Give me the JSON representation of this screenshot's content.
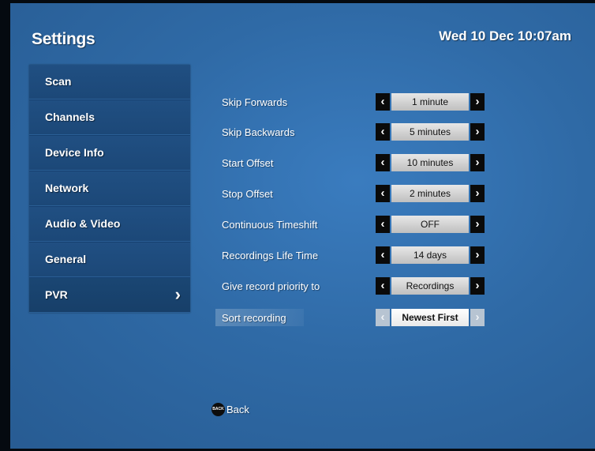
{
  "header": {
    "title": "Settings",
    "datetime": "Wed 10 Dec 10:07am"
  },
  "sidebar": {
    "items": [
      {
        "label": "Scan"
      },
      {
        "label": "Channels"
      },
      {
        "label": "Device Info"
      },
      {
        "label": "Network"
      },
      {
        "label": "Audio & Video"
      },
      {
        "label": "General"
      },
      {
        "label": "PVR",
        "active": true
      }
    ],
    "active_arrow": "›"
  },
  "settings": {
    "rows": [
      {
        "label": "Skip Forwards",
        "value": "1 minute"
      },
      {
        "label": "Skip Backwards",
        "value": "5 minutes"
      },
      {
        "label": "Start Offset",
        "value": "10 minutes"
      },
      {
        "label": "Stop Offset",
        "value": "2 minutes"
      },
      {
        "label": "Continuous Timeshift",
        "value": "OFF"
      },
      {
        "label": "Recordings Life Time",
        "value": "14 days"
      },
      {
        "label": "Give record priority to",
        "value": "Recordings"
      },
      {
        "label": "Sort recording",
        "value": "Newest First",
        "selected": true
      }
    ],
    "prev_glyph": "‹",
    "next_glyph": "›"
  },
  "footer": {
    "back_icon_text": "BACK",
    "back_label": "Back"
  },
  "colors": {
    "background": "#2d6aa8",
    "sidebar": "#1e4f84",
    "stepper_button": "#0a0a0a",
    "value_box": "#d9d9d9"
  }
}
